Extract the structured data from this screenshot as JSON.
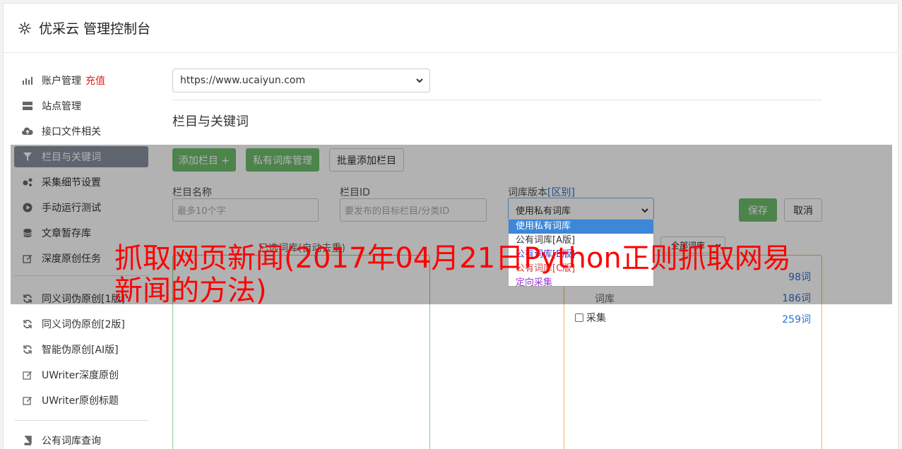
{
  "header": {
    "title": "优采云 管理控制台"
  },
  "sidebar": {
    "items": [
      {
        "label": "账户管理",
        "icon": "bar-chart-icon",
        "extra": "充值"
      },
      {
        "label": "站点管理",
        "icon": "server-icon"
      },
      {
        "label": "接口文件相关",
        "icon": "cloud-upload-icon"
      },
      {
        "label": "栏目与关键词",
        "icon": "filter-icon",
        "active": true
      },
      {
        "label": "采集细节设置",
        "icon": "cogs-icon"
      },
      {
        "label": "手动运行测试",
        "icon": "play-circle-icon"
      },
      {
        "label": "文章暂存库",
        "icon": "database-icon"
      },
      {
        "label": "深度原创任务",
        "icon": "edit-icon"
      },
      {
        "label": "同义词伪原创[1版]",
        "icon": "refresh-icon"
      },
      {
        "label": "同义词伪原创[2版]",
        "icon": "refresh-icon"
      },
      {
        "label": "智能伪原创[AI版]",
        "icon": "refresh-icon"
      },
      {
        "label": "UWriter深度原创",
        "icon": "edit-icon"
      },
      {
        "label": "UWriter原创标题",
        "icon": "edit-icon"
      },
      {
        "label": "公有词库查询",
        "icon": "book-icon"
      }
    ]
  },
  "main": {
    "site_select": "https://www.ucaiyun.com",
    "section_title": "栏目与关键词",
    "buttons": {
      "add_column": "添加栏目 +",
      "private_lib": "私有词库管理",
      "batch_add": "批量添加栏目",
      "save": "保存",
      "cancel": "取消"
    },
    "form": {
      "name_label": "栏目名称",
      "name_placeholder": "最多10个字",
      "id_label": "栏目ID",
      "id_placeholder": "要发布的目标栏目/分类ID",
      "version_label": "词库版本",
      "version_link": "[区别]",
      "version_value": "使用私有词库"
    },
    "dropdown_options": [
      {
        "label": "使用私有词库",
        "color": "#ffffff"
      },
      {
        "label": "公有词库[A版]",
        "color": "#333333"
      },
      {
        "label": "公有词库[B版]",
        "color": "#3b3bd6"
      },
      {
        "label": "公有词库[C版]",
        "color": "#d04040"
      },
      {
        "label": "定向采集",
        "color": "#9a3ad6"
      }
    ],
    "left_panel_caption": "已选词库(自动去重)",
    "right_filter": "全部词库",
    "right_caption": "词库",
    "counts": [
      "98词",
      "186词",
      "259词"
    ],
    "checkbox_label": "采集"
  },
  "overlay_title": "抓取网页新闻(2017年04月21日Python正则抓取网易新闻的方法)"
}
